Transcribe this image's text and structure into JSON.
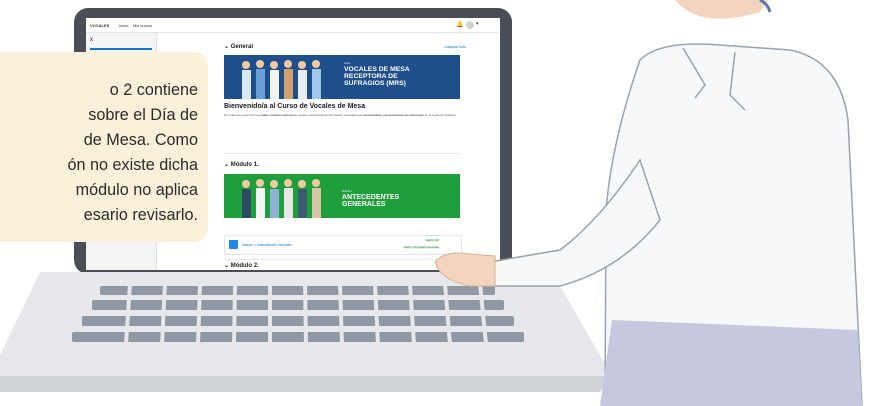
{
  "callout": {
    "text": "o 2 contiene\nsobre el Día de\nde Mesa. Como\nón no existe dicha\n módulo no aplica\nesario revisarlo."
  },
  "app": {
    "brand": "VOCALES",
    "nav": [
      "Inicio",
      "Mis cursos"
    ],
    "sidebar_item": "x",
    "collapse_all": "Colapsar todo",
    "sections": [
      {
        "title": "General",
        "banner": {
          "small": "Curso",
          "lines": [
            "VOCALES DE MESA",
            "RECEPTORA DE",
            "SUFRAGIOS (MRS)"
          ]
        },
        "welcome": "Bienvenido/a al Curso de Vocales de Mesa",
        "intro_parts": [
          "Te invitamos a recorrer los ",
          "cuatro módulos del curso",
          ", donde encontrarás la información necesaria para ",
          "desempeñar correctamente tus funciones",
          " en el Local de Votación."
        ]
      },
      {
        "title": "Módulo 1.",
        "banner": {
          "small": "Módulo 1",
          "lines": [
            "ANTECEDENTES",
            "GENERALES"
          ]
        },
        "activity": {
          "label": "Módulo 1: Antecedentes Generales",
          "badge1": "Hecho: Ver",
          "badge2": "Hecho: Completar la actividad"
        }
      },
      {
        "title": "Módulo 2."
      }
    ]
  },
  "colors": {
    "blue_banner": "#1f4e8c",
    "green_banner": "#1f9f3b",
    "orange_banner": "#ef7a2e",
    "accent": "#1177d1",
    "callout_bg": "#fbf0d9"
  }
}
